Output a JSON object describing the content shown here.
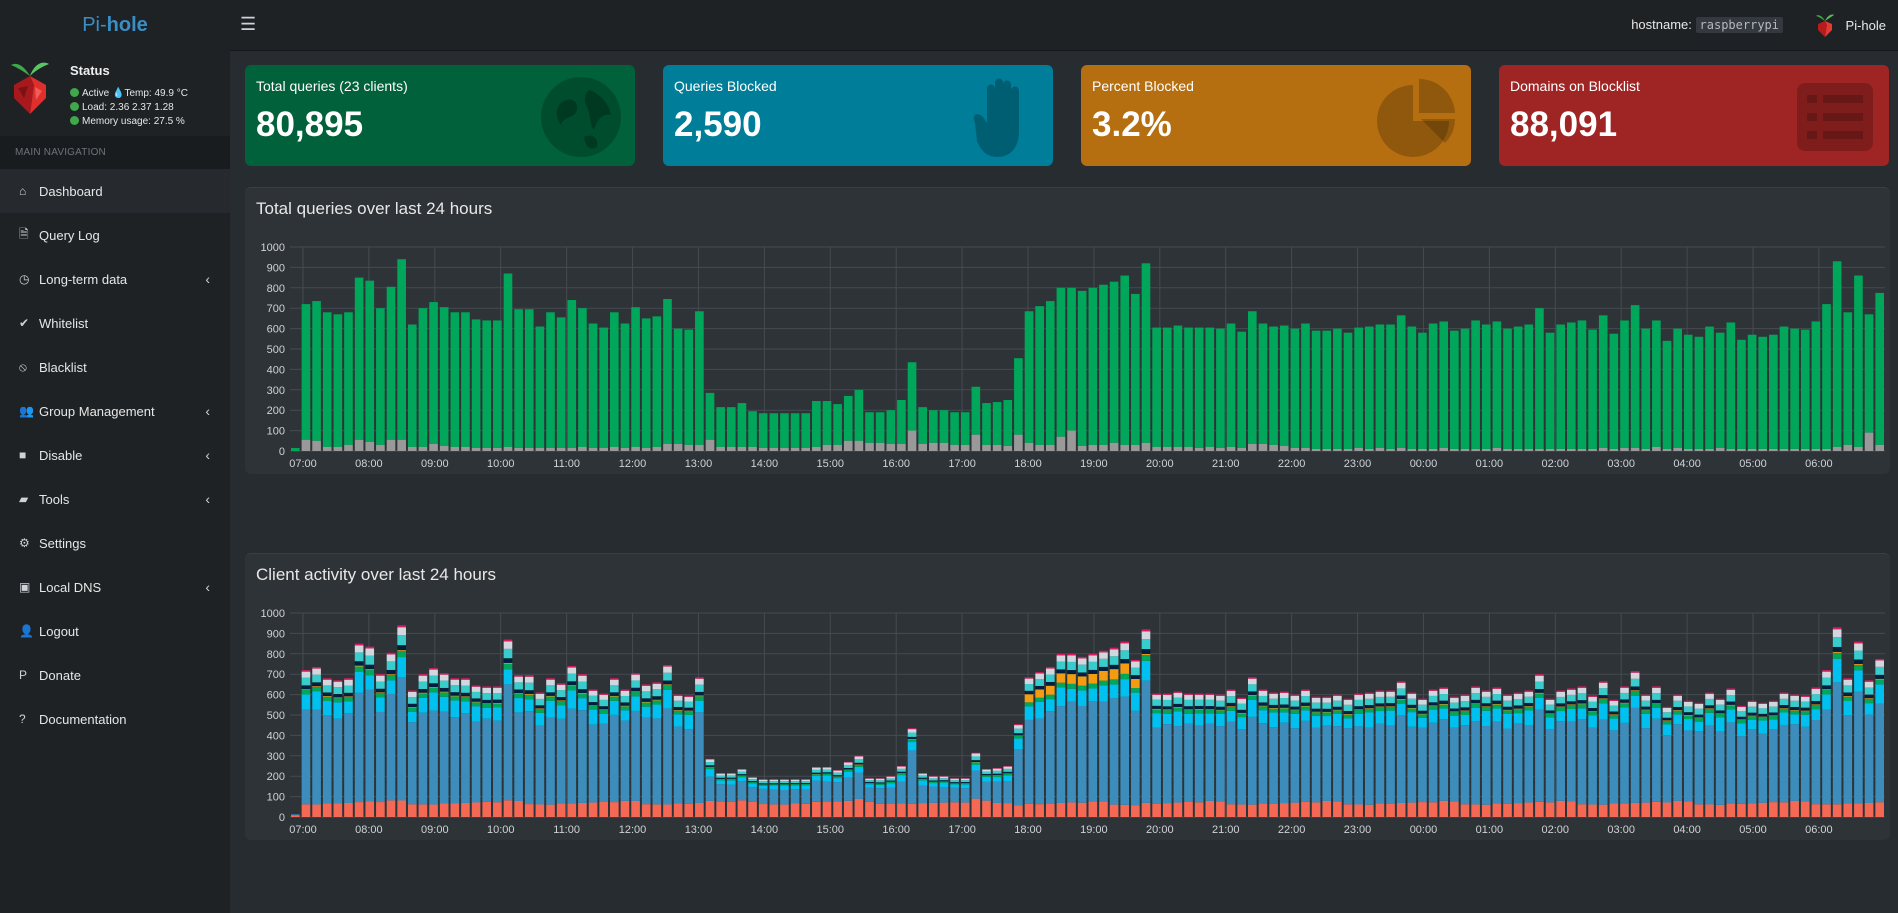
{
  "app": {
    "logo_prefix": "Pi-",
    "logo_suffix": "hole",
    "hostname_label": "hostname:",
    "hostname_value": "raspberrypi",
    "user_name": "Pi-hole"
  },
  "status": {
    "title": "Status",
    "active": "Active",
    "temp": "Temp: 49.9 °C",
    "load": "Load:  2.36  2.37  1.28",
    "memory": "Memory usage:  27.5 %"
  },
  "nav": {
    "header": "MAIN NAVIGATION",
    "items": [
      {
        "label": "Dashboard",
        "icon": "home-icon",
        "active": true,
        "chevron": false
      },
      {
        "label": "Query Log",
        "icon": "file-icon",
        "active": false,
        "chevron": false
      },
      {
        "label": "Long-term data",
        "icon": "clock-icon",
        "active": false,
        "chevron": true
      },
      {
        "label": "Whitelist",
        "icon": "check-circle-icon",
        "active": false,
        "chevron": false
      },
      {
        "label": "Blacklist",
        "icon": "ban-icon",
        "active": false,
        "chevron": false
      },
      {
        "label": "Group Management",
        "icon": "users-icon",
        "active": false,
        "chevron": true
      },
      {
        "label": "Disable",
        "icon": "stop-icon",
        "active": false,
        "chevron": true
      },
      {
        "label": "Tools",
        "icon": "folder-icon",
        "active": false,
        "chevron": true
      },
      {
        "label": "Settings",
        "icon": "gears-icon",
        "active": false,
        "chevron": false
      },
      {
        "label": "Local DNS",
        "icon": "address-book-icon",
        "active": false,
        "chevron": true
      },
      {
        "label": "Logout",
        "icon": "user-times-icon",
        "active": false,
        "chevron": false
      },
      {
        "label": "Donate",
        "icon": "paypal-icon",
        "active": false,
        "chevron": false
      },
      {
        "label": "Documentation",
        "icon": "question-circle-icon",
        "active": false,
        "chevron": false
      }
    ]
  },
  "stats": [
    {
      "title": "Total queries (23 clients)",
      "value": "80,895",
      "color": "#00613a",
      "icon": "globe-icon"
    },
    {
      "title": "Queries Blocked",
      "value": "2,590",
      "color": "#007e99",
      "icon": "hand-icon"
    },
    {
      "title": "Percent Blocked",
      "value": "3.2%",
      "color": "#b56e10",
      "icon": "pie-chart-icon"
    },
    {
      "title": "Domains on Blocklist",
      "value": "88,091",
      "color": "#9f2525",
      "icon": "list-alt-icon"
    }
  ],
  "chart_data": [
    {
      "type": "bar",
      "title": "Total queries over last 24 hours",
      "ylim": [
        0,
        1000
      ],
      "yticks": [
        "1000",
        "900",
        "800",
        "700",
        "600",
        "500",
        "400",
        "300",
        "200",
        "100",
        "0"
      ],
      "xticks": [
        "07:00",
        "08:00",
        "09:00",
        "10:00",
        "11:00",
        "12:00",
        "13:00",
        "14:00",
        "15:00",
        "16:00",
        "17:00",
        "18:00",
        "19:00",
        "20:00",
        "21:00",
        "22:00",
        "23:00",
        "00:00",
        "01:00",
        "02:00",
        "03:00",
        "04:00",
        "05:00",
        "06:00"
      ],
      "grid": true,
      "colors": {
        "permitted": "#00a65a",
        "blocked": "#999999"
      },
      "series": [
        {
          "values": [
            15,
            720,
            735,
            680,
            670,
            680,
            850,
            835,
            700,
            805,
            940,
            620,
            700,
            730,
            705,
            680,
            680,
            645,
            640,
            640,
            870,
            695,
            695,
            610,
            680,
            655,
            740,
            700,
            625,
            605,
            680,
            625,
            705,
            650,
            660,
            745,
            600,
            595,
            685,
            285,
            215,
            215,
            235,
            195,
            185,
            185,
            185,
            185,
            185,
            245,
            245,
            230,
            270,
            300,
            190,
            190,
            200,
            250,
            435,
            215,
            200,
            200,
            190,
            190,
            315,
            235,
            240,
            250,
            455,
            685,
            710,
            735,
            800,
            800,
            785,
            800,
            815,
            830,
            860,
            770,
            920,
            605,
            605,
            615,
            605,
            605,
            605,
            600,
            625,
            585,
            685,
            625,
            610,
            615,
            600,
            625,
            590,
            590,
            600,
            580,
            605,
            610,
            620,
            620,
            665,
            610,
            580,
            625,
            635,
            590,
            600,
            640,
            620,
            635,
            600,
            610,
            620,
            700,
            580,
            620,
            630,
            640,
            595,
            665,
            575,
            640,
            715,
            600,
            640,
            540,
            600,
            570,
            560,
            610,
            580,
            630,
            545,
            570,
            560,
            570,
            610,
            600,
            595,
            635,
            720,
            930,
            680,
            860,
            670,
            775
          ]
        },
        {
          "values": [
            0,
            55,
            50,
            20,
            20,
            30,
            55,
            45,
            30,
            55,
            55,
            20,
            20,
            35,
            25,
            20,
            20,
            15,
            15,
            15,
            20,
            15,
            15,
            15,
            15,
            15,
            15,
            20,
            15,
            15,
            20,
            15,
            20,
            15,
            20,
            35,
            35,
            30,
            30,
            55,
            20,
            20,
            20,
            20,
            15,
            15,
            15,
            15,
            15,
            20,
            30,
            30,
            50,
            50,
            40,
            40,
            35,
            35,
            100,
            35,
            40,
            40,
            30,
            30,
            80,
            30,
            30,
            25,
            80,
            40,
            30,
            30,
            70,
            100,
            25,
            30,
            30,
            40,
            30,
            30,
            40,
            20,
            20,
            20,
            20,
            15,
            20,
            15,
            20,
            15,
            35,
            35,
            30,
            25,
            15,
            15,
            10,
            10,
            10,
            10,
            15,
            10,
            15,
            10,
            15,
            10,
            10,
            10,
            15,
            10,
            10,
            10,
            10,
            15,
            10,
            10,
            10,
            10,
            10,
            10,
            10,
            10,
            10,
            15,
            10,
            15,
            15,
            10,
            20,
            10,
            15,
            10,
            10,
            10,
            15,
            10,
            10,
            10,
            10,
            10,
            10,
            10,
            10,
            10,
            10,
            20,
            30,
            20,
            90,
            30
          ]
        }
      ]
    },
    {
      "type": "bar",
      "title": "Client activity over last 24 hours",
      "ylim": [
        0,
        1000
      ],
      "yticks": [
        "1000",
        "900",
        "800",
        "700",
        "600",
        "500",
        "400",
        "300",
        "200",
        "100",
        "0"
      ],
      "xticks": [
        "07:00",
        "08:00",
        "09:00",
        "10:00",
        "11:00",
        "12:00",
        "13:00",
        "14:00",
        "15:00",
        "16:00",
        "17:00",
        "18:00",
        "19:00",
        "20:00",
        "21:00",
        "22:00",
        "23:00",
        "00:00",
        "01:00",
        "02:00",
        "03:00",
        "04:00",
        "05:00",
        "06:00"
      ],
      "grid": true,
      "colors": [
        "#f56954",
        "#3c8dbc",
        "#00c0ef",
        "#00a65a",
        "#f39c12",
        "#001f3f",
        "#39cccc",
        "#d2d6de",
        "#d81b60"
      ],
      "totals": [
        15,
        720,
        735,
        680,
        670,
        680,
        850,
        835,
        700,
        805,
        940,
        620,
        700,
        730,
        705,
        680,
        680,
        645,
        640,
        640,
        870,
        695,
        695,
        610,
        680,
        655,
        740,
        700,
        625,
        605,
        680,
        625,
        705,
        650,
        660,
        745,
        600,
        595,
        685,
        285,
        215,
        215,
        235,
        195,
        185,
        185,
        185,
        185,
        185,
        245,
        245,
        230,
        270,
        300,
        190,
        190,
        200,
        250,
        435,
        215,
        200,
        200,
        190,
        190,
        315,
        235,
        240,
        250,
        455,
        685,
        710,
        735,
        800,
        800,
        785,
        800,
        815,
        830,
        860,
        770,
        920,
        605,
        605,
        615,
        605,
        605,
        605,
        600,
        625,
        585,
        685,
        625,
        610,
        615,
        600,
        625,
        590,
        590,
        600,
        580,
        605,
        610,
        620,
        620,
        665,
        610,
        580,
        625,
        635,
        590,
        600,
        640,
        620,
        635,
        600,
        610,
        620,
        700,
        580,
        620,
        630,
        640,
        595,
        665,
        575,
        640,
        715,
        600,
        640,
        540,
        600,
        570,
        560,
        610,
        580,
        630,
        545,
        570,
        560,
        570,
        610,
        600,
        595,
        635,
        720,
        930,
        680,
        860,
        670,
        775
      ]
    }
  ]
}
